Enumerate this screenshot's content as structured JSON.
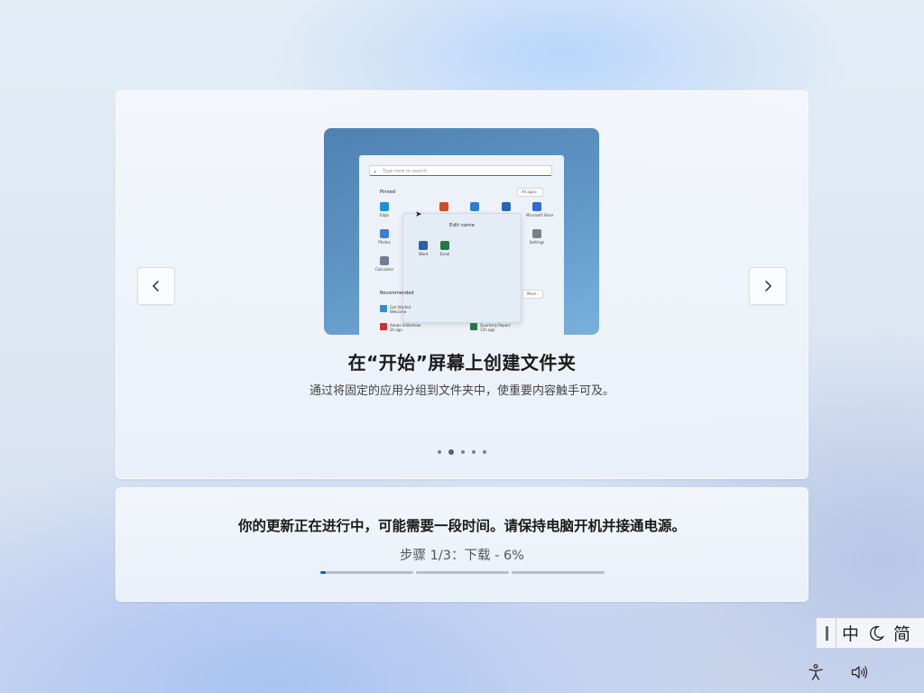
{
  "carousel": {
    "prev_label": "Previous",
    "next_label": "Next",
    "slide_title": "在“开始”屏幕上创建文件夹",
    "slide_description": "通过将固定的应用分组到文件夹中，使重要内容触手可及。",
    "slide_count": 5,
    "active_slide": 2,
    "illustration": {
      "search_placeholder": "Type here to search",
      "pinned_label": "Pinned",
      "all_apps_label": "All apps ›",
      "recommended_label": "Recommended",
      "more_label": "More ›",
      "folder_title": "Edit name",
      "apps": [
        {
          "name": "Edge",
          "color": "#1f8fd6"
        },
        {
          "name": "",
          "color": "#c94f2b"
        },
        {
          "name": "",
          "color": "#2a7fd0"
        },
        {
          "name": "",
          "color": "#2565b8"
        },
        {
          "name": "Microsoft Store",
          "color": "#2f6bd0"
        },
        {
          "name": "Photos",
          "color": "#3d7fcf"
        },
        {
          "name": "Settings",
          "color": "#7a7f88"
        },
        {
          "name": "Calculator",
          "color": "#6d7f99"
        }
      ],
      "folder_apps": [
        {
          "name": "Word",
          "color": "#2b5fb3"
        },
        {
          "name": "Excel",
          "color": "#1f7a43"
        }
      ],
      "recommended": [
        {
          "name": "Get Started",
          "sub": "Welcome",
          "color": "#2f8fd8"
        },
        {
          "name": "Adobe Slideshow",
          "sub": "2h ago",
          "color": "#d03030"
        },
        {
          "name": "Quarterly Report",
          "sub": "12h ago",
          "color": "#1f7a43"
        }
      ]
    }
  },
  "status": {
    "message": "你的更新正在进行中，可能需要一段时间。请保持电脑开机并接通电源。",
    "step_text": "步骤 1/3：下载 - 6%",
    "steps": 3,
    "current_step_progress": 0.06,
    "accent_color": "#0a5fc4"
  },
  "ime": {
    "mode_label": "中",
    "script_label": "简"
  },
  "tray": {
    "accessibility_icon": "accessibility-icon",
    "volume_icon": "volume-icon"
  }
}
